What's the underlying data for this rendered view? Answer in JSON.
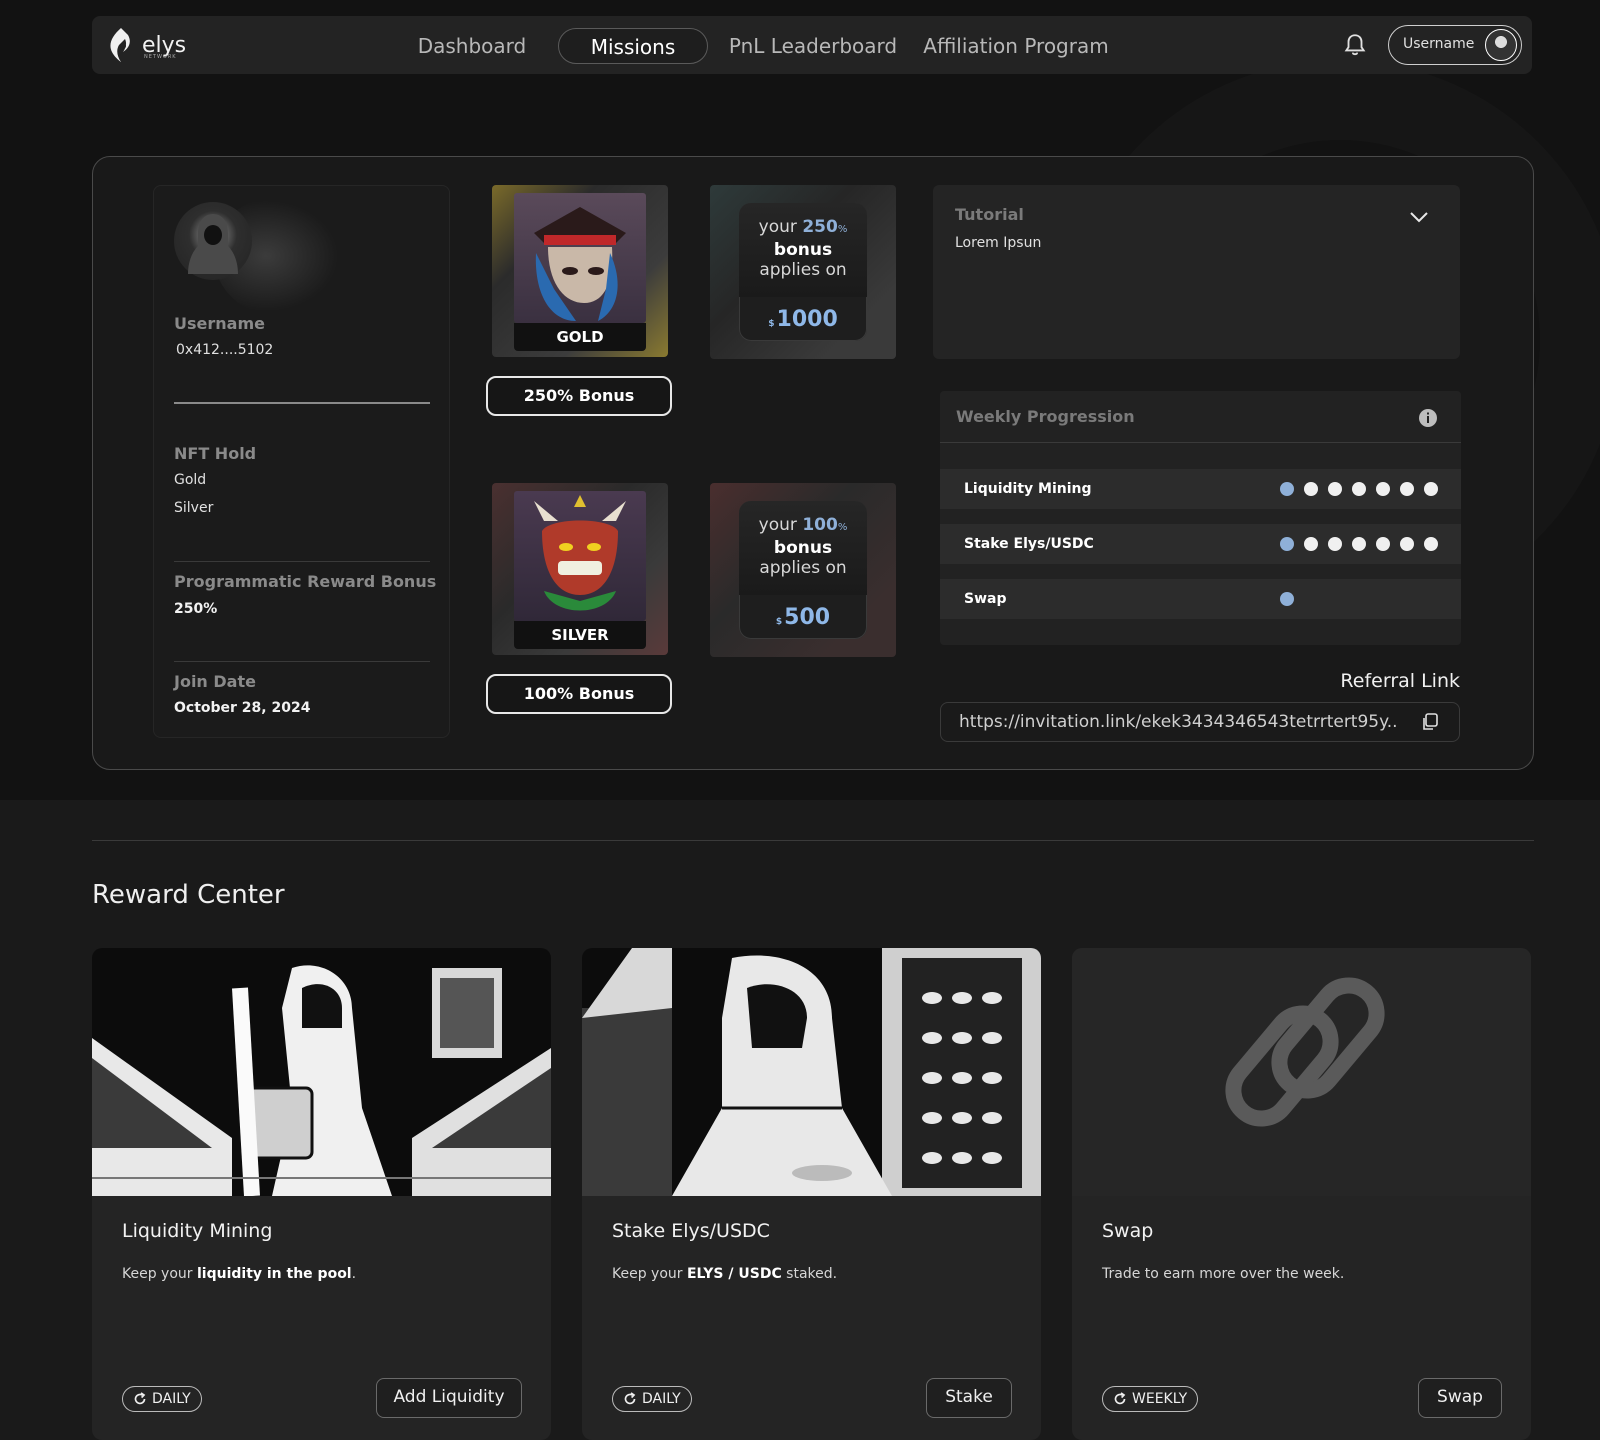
{
  "nav": {
    "logo_text": "elys",
    "logo_sub": "NETWORK",
    "links": [
      "Dashboard",
      "Missions",
      "PnL Leaderboard",
      "Affiliation Program"
    ],
    "active": "Missions",
    "user_label": "Username"
  },
  "profile": {
    "username_label": "Username",
    "username_value": "0x412....5102",
    "nft_hold_label": "NFT Hold",
    "nft_hold_items": [
      "Gold",
      "Silver"
    ],
    "reward_bonus_label": "Programmatic Reward Bonus",
    "reward_bonus_value": "250%",
    "join_date_label": "Join Date",
    "join_date_value": "October 28, 2024"
  },
  "nfts": [
    {
      "tier": "GOLD",
      "bonus_button": "250% Bonus",
      "bonus_prefix": "your",
      "bonus_pct": "250",
      "bonus_pct_unit": "%",
      "bonus_word": "bonus",
      "applies": "applies on",
      "currency": "$",
      "amount": "1000"
    },
    {
      "tier": "SILVER",
      "bonus_button": "100% Bonus",
      "bonus_prefix": "your",
      "bonus_pct": "100",
      "bonus_pct_unit": "%",
      "bonus_word": "bonus",
      "applies": "applies on",
      "currency": "$",
      "amount": "500"
    }
  ],
  "tutorial": {
    "title": "Tutorial",
    "body": "Lorem Ipsun"
  },
  "weekly": {
    "title": "Weekly Progression",
    "rows": [
      {
        "label": "Liquidity Mining",
        "total": 7,
        "done": 1
      },
      {
        "label": "Stake Elys/USDC",
        "total": 7,
        "done": 1
      },
      {
        "label": "Swap",
        "total": 1,
        "done": 1
      }
    ]
  },
  "referral": {
    "label": "Referral Link",
    "link": "https://invitation.link/ekek3434346543tetrrtert95y..."
  },
  "reward_center": {
    "title": "Reward Center",
    "cards": [
      {
        "name": "Liquidity Mining",
        "desc_pre": "Keep your ",
        "desc_bold": "liquidity in the pool",
        "desc_post": ".",
        "freq": "DAILY",
        "action": "Add Liquidity"
      },
      {
        "name": "Stake Elys/USDC",
        "desc_pre": "Keep your ",
        "desc_bold": "ELYS / USDC",
        "desc_post": " staked.",
        "freq": "DAILY",
        "action": "Stake"
      },
      {
        "name": "Swap",
        "desc_pre": "Trade to earn more over the week.",
        "desc_bold": "",
        "desc_post": "",
        "freq": "WEEKLY",
        "action": "Swap"
      }
    ]
  },
  "colors": {
    "accent_dot": "#8fb0d8",
    "amount": "#8fb8e8",
    "background": "#161616"
  }
}
